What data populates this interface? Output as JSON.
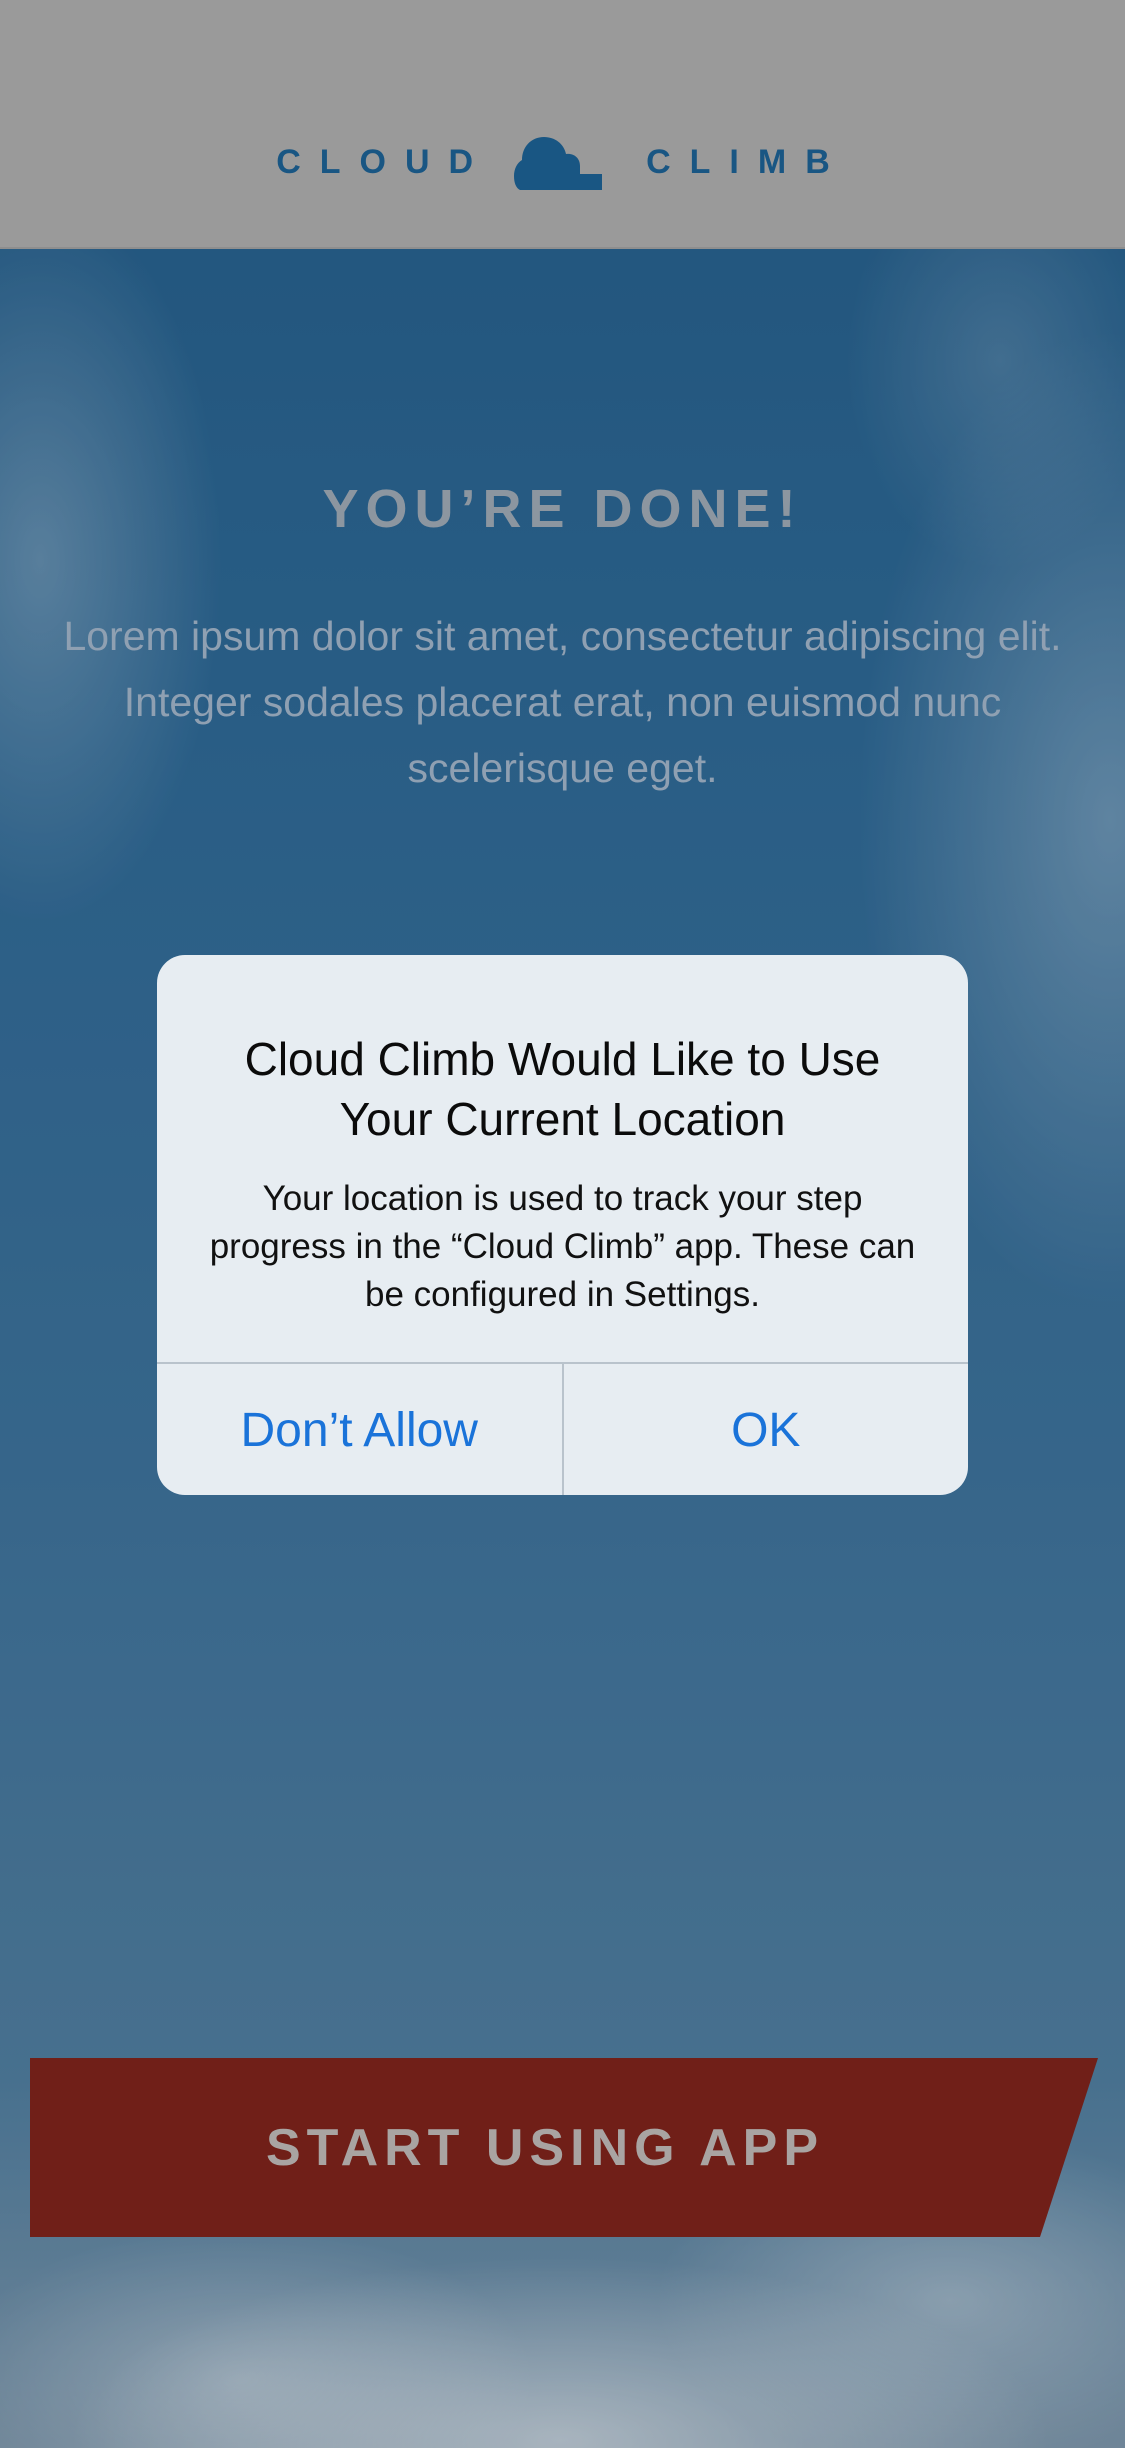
{
  "header": {
    "brand_left": "CLOUD",
    "brand_right": "CLIMB",
    "logo_icon": "cloud-icon"
  },
  "content": {
    "title": "YOU’RE DONE!",
    "body": "Lorem ipsum dolor sit amet, consectetur adipiscing elit. Integer sodales placerat erat, non euismod nunc scelerisque eget."
  },
  "alert": {
    "title": "Cloud Climb Would Like to Use Your Current Location",
    "message": "Your location is used to track your step progress in the “Cloud Climb” app. These can be configured in Settings.",
    "deny_label": "Don’t Allow",
    "ok_label": "OK"
  },
  "cta": {
    "label": "START USING APP"
  },
  "colors": {
    "brand_blue": "#195683",
    "header_bg": "#9a9a9a",
    "cta_red": "#701f18",
    "ios_link": "#1a73d9"
  }
}
